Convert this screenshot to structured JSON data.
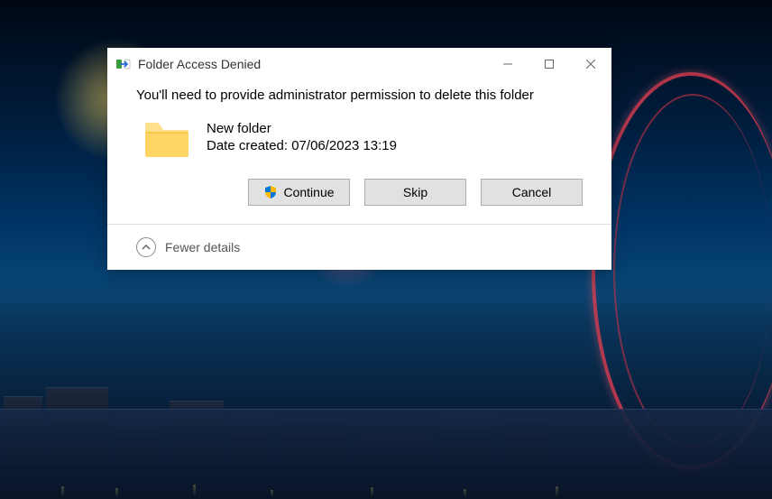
{
  "dialog": {
    "title": "Folder Access Denied",
    "message": "You'll need to provide administrator permission to delete this folder",
    "file": {
      "name": "New folder",
      "meta": "Date created: 07/06/2023 13:19"
    },
    "buttons": {
      "continue": "Continue",
      "skip": "Skip",
      "cancel": "Cancel"
    },
    "expander": "Fewer details"
  }
}
